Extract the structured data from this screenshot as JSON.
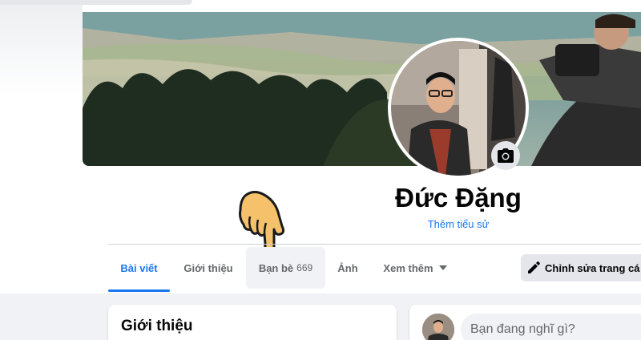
{
  "profile": {
    "name": "Đức Đặng",
    "bio_link": "Thêm tiểu sử"
  },
  "tabs": [
    {
      "label": "Bài viết",
      "count": ""
    },
    {
      "label": "Giới thiệu",
      "count": ""
    },
    {
      "label": "Bạn bè",
      "count": "669"
    },
    {
      "label": "Ảnh",
      "count": ""
    },
    {
      "label": "Xem thêm",
      "count": ""
    }
  ],
  "actions": {
    "edit_profile_label": "Chỉnh sửa trang cá"
  },
  "intro_card": {
    "title": "Giới thiệu"
  },
  "composer": {
    "placeholder": "Bạn đang nghĩ gì?"
  },
  "colors": {
    "accent": "#1877f2",
    "text_secondary": "#65676b",
    "button_gray": "#e4e6eb",
    "page_bg": "#f0f2f5"
  },
  "icons": {
    "camera": "camera-icon",
    "pencil": "pencil-icon",
    "pointer": "pointing-hand-icon"
  }
}
